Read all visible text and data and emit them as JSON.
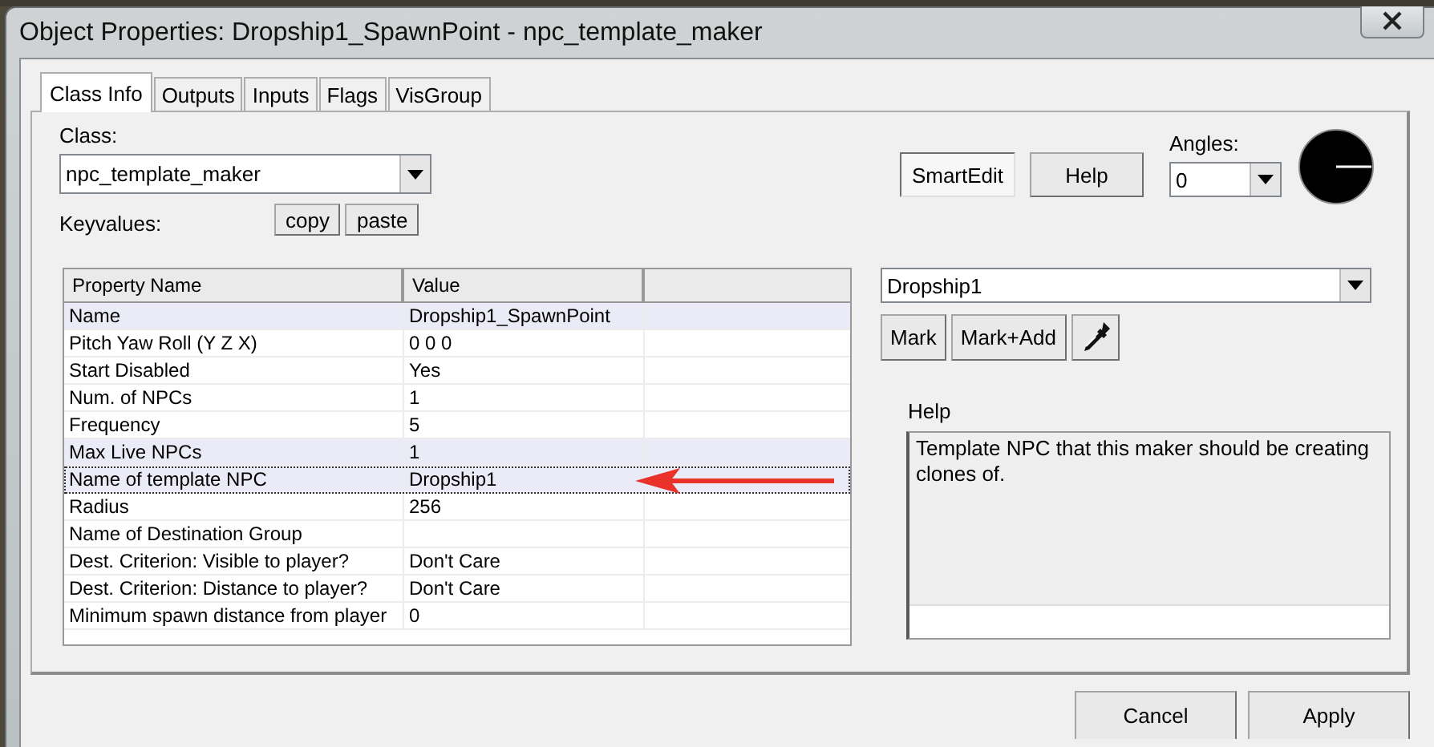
{
  "window": {
    "title": "Object Properties: Dropship1_SpawnPoint - npc_template_maker"
  },
  "tabs": [
    {
      "label": "Class Info",
      "selected": true
    },
    {
      "label": "Outputs",
      "selected": false
    },
    {
      "label": "Inputs",
      "selected": false
    },
    {
      "label": "Flags",
      "selected": false
    },
    {
      "label": "VisGroup",
      "selected": false
    }
  ],
  "class_field": {
    "label": "Class:",
    "value": "npc_template_maker"
  },
  "keyvalues": {
    "label": "Keyvalues:",
    "buttons": [
      "copy",
      "paste"
    ]
  },
  "mode_buttons": [
    {
      "label": "SmartEdit",
      "selected": true
    },
    {
      "label": "Help",
      "selected": false
    }
  ],
  "angles": {
    "label": "Angles:",
    "value": "0"
  },
  "table": {
    "columns": [
      "Property Name",
      "Value"
    ],
    "rows": [
      {
        "name": "Name",
        "value": "Dropship1_SpawnPoint",
        "selected": true,
        "focused": false
      },
      {
        "name": "Pitch Yaw Roll (Y Z X)",
        "value": "0 0 0",
        "selected": false,
        "focused": false
      },
      {
        "name": "Start Disabled",
        "value": "Yes",
        "selected": false,
        "focused": false
      },
      {
        "name": "Num. of NPCs",
        "value": "1",
        "selected": false,
        "focused": false
      },
      {
        "name": "Frequency",
        "value": "5",
        "selected": false,
        "focused": false
      },
      {
        "name": "Max Live NPCs",
        "value": "1",
        "selected": true,
        "focused": false
      },
      {
        "name": "Name of template NPC",
        "value": "Dropship1",
        "selected": true,
        "focused": true
      },
      {
        "name": "Radius",
        "value": "256",
        "selected": false,
        "focused": false
      },
      {
        "name": "Name of Destination Group",
        "selected": false,
        "focused": false
      },
      {
        "name": "Dest. Criterion: Visible to player?",
        "value": "Don't Care",
        "selected": false,
        "focused": false
      },
      {
        "name": "Dest. Criterion: Distance to player?",
        "value": "Don't Care",
        "selected": false,
        "focused": false
      },
      {
        "name": "Minimum spawn distance from player",
        "value": "0",
        "selected": false,
        "focused": false
      }
    ]
  },
  "target": {
    "value": "Dropship1",
    "buttons": [
      "Mark",
      "Mark+Add"
    ]
  },
  "help": {
    "label": "Help",
    "text": "Template NPC that this maker should be creating clones of."
  },
  "footer_buttons": [
    "Cancel",
    "Apply"
  ]
}
